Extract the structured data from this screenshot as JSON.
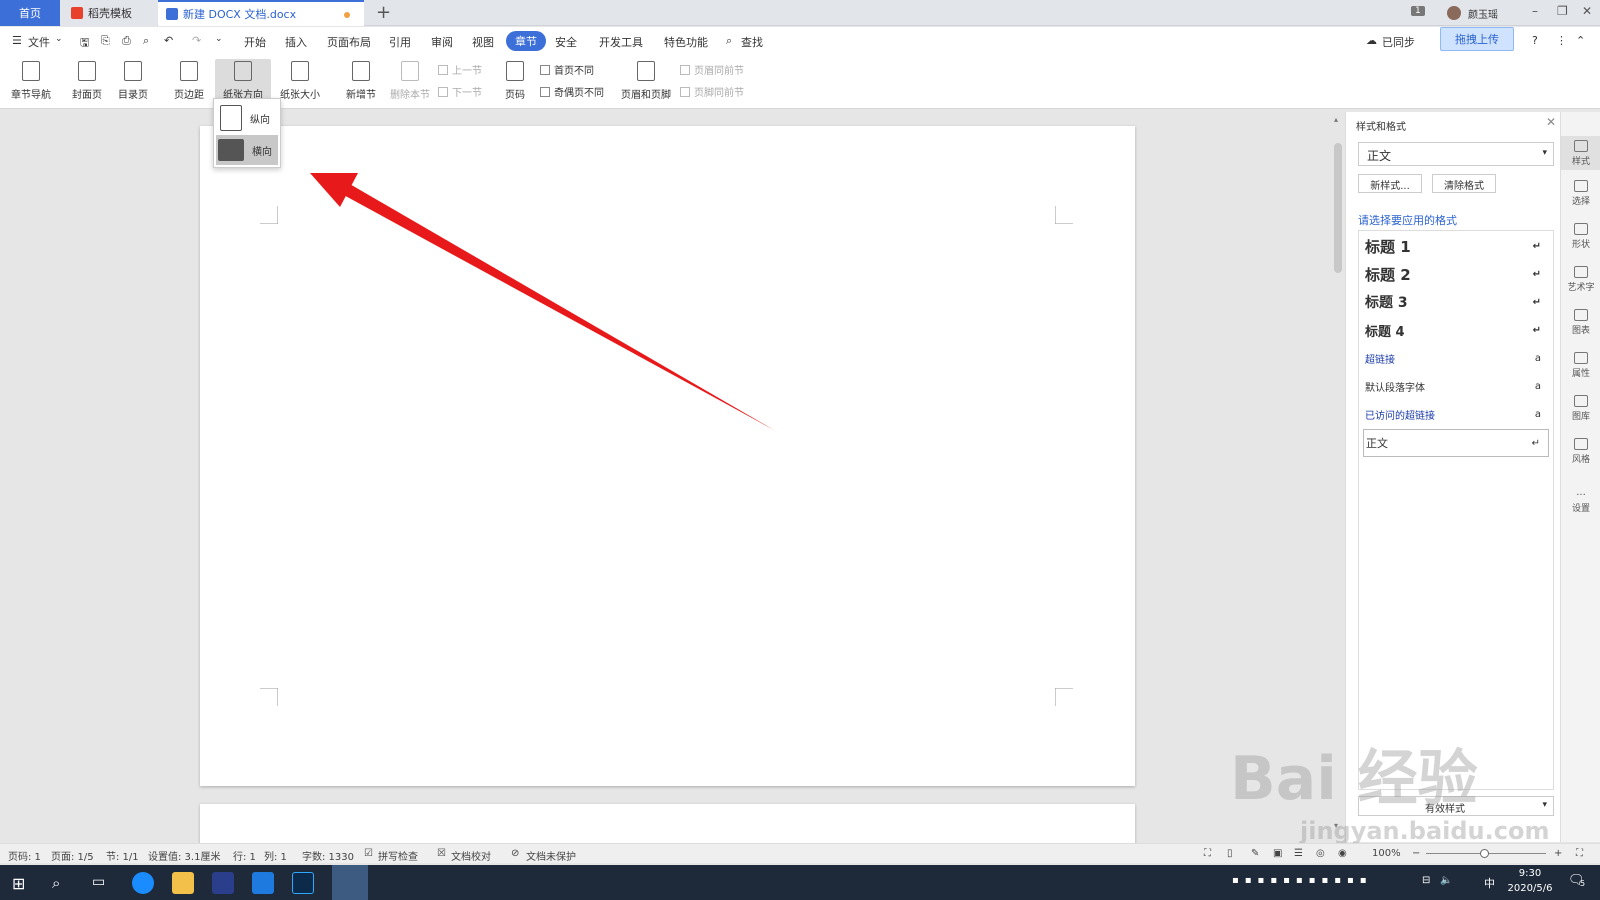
{
  "tabs": {
    "home": "首页",
    "template": "稻壳模板",
    "document": "新建 DOCX 文档.docx",
    "new_tab": "+"
  },
  "titlebar": {
    "badge": "1",
    "username": "颜玉瑶",
    "sync": "已同步",
    "upload": "拖拽上传"
  },
  "menu": {
    "file": "文件",
    "items": [
      "开始",
      "插入",
      "页面布局",
      "引用",
      "审阅",
      "视图",
      "章节",
      "安全",
      "开发工具",
      "特色功能"
    ],
    "active": "章节",
    "search": "查找"
  },
  "ribbon": {
    "chapter_nav": "章节导航",
    "cover": "封面页",
    "toc": "目录页",
    "margin": "页边距",
    "orientation": "纸张方向",
    "size": "纸张大小",
    "new_section": "新增节",
    "delete_section": "删除本节",
    "prev_section": "上一节",
    "next_section": "下一节",
    "page_number": "页码",
    "first_diff": "首页不同",
    "odd_even_diff": "奇偶页不同",
    "header_footer": "页眉和页脚",
    "header_same": "页眉同前节",
    "footer_same": "页脚同前节"
  },
  "orientation_menu": {
    "portrait": "纵向",
    "landscape": "横向"
  },
  "styles_panel": {
    "title": "样式和格式",
    "current": "正文",
    "new_style": "新样式...",
    "clear_format": "清除格式",
    "prompt": "请选择要应用的格式",
    "items": [
      {
        "name": "标题 1",
        "mark": "↵"
      },
      {
        "name": "标题 2",
        "mark": "↵"
      },
      {
        "name": "标题 3",
        "mark": "↵"
      },
      {
        "name": "标题 4",
        "mark": "↵"
      },
      {
        "name": "超链接",
        "mark": "a"
      },
      {
        "name": "默认段落字体",
        "mark": "a"
      },
      {
        "name": "已访问的超链接",
        "mark": "a"
      },
      {
        "name": "正文",
        "mark": "↵"
      }
    ],
    "show_label": "有效样式"
  },
  "right_sidebar": [
    "样式",
    "选择",
    "形状",
    "艺术字",
    "图表",
    "属性",
    "图库",
    "风格",
    "设置"
  ],
  "status": {
    "page_no": "页码: 1",
    "page": "页面: 1/5",
    "section": "节: 1/1",
    "setting": "设置值: 3.1厘米",
    "row": "行: 1",
    "col": "列: 1",
    "words": "字数: 1330",
    "spell": "拼写检查",
    "proof": "文档校对",
    "protect": "文档未保护",
    "zoom": "100%"
  },
  "taskbar": {
    "ime": "中",
    "time": "9:30",
    "date": "2020/5/6",
    "notif": "5"
  },
  "watermark": "Bai 经验",
  "watermark_url": "jingyan.baidu.com",
  "colors": {
    "accent": "#3d6fd8",
    "arrow": "#e8191a",
    "taskbar": "#1e2a3a"
  }
}
